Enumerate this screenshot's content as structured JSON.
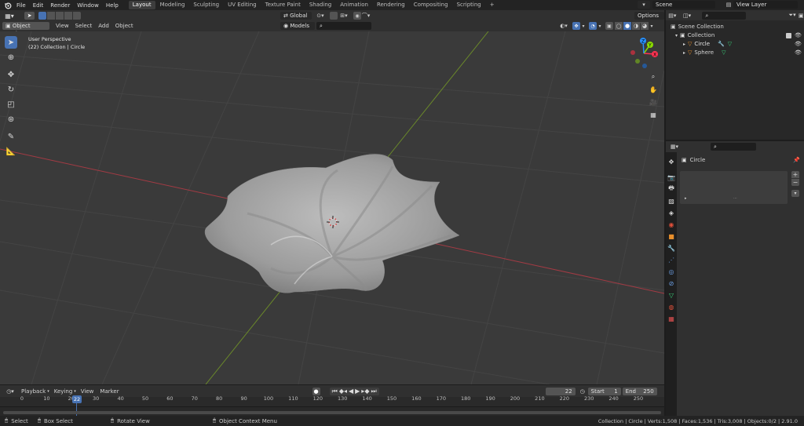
{
  "menubar": {
    "items": [
      "File",
      "Edit",
      "Render",
      "Window",
      "Help"
    ],
    "workspaces": [
      "Layout",
      "Modeling",
      "Sculpting",
      "UV Editing",
      "Texture Paint",
      "Shading",
      "Animation",
      "Rendering",
      "Compositing",
      "Scripting"
    ],
    "active_workspace": "Layout",
    "add_tab": "+",
    "scene": "Scene",
    "view_layer": "View Layer"
  },
  "viewport_header": {
    "mode": "Object Mode",
    "menus": [
      "View",
      "Select",
      "Add",
      "Object"
    ],
    "transform_orientation": "Global",
    "collection_filter": "Models",
    "options": "Options"
  },
  "viewport": {
    "perspective_label": "User Perspective",
    "collection_label": "(22) Collection | Circle",
    "gizmo": {
      "x": "X",
      "y": "Y",
      "z": "Z"
    },
    "colors": {
      "x_axis": "#ff3352",
      "y_axis": "#8bdc00",
      "z_axis": "#2890ff"
    }
  },
  "outliner": {
    "root": "Scene Collection",
    "collection": "Collection",
    "objects": [
      "Circle",
      "Sphere"
    ]
  },
  "properties": {
    "object_name": "Circle"
  },
  "timeline": {
    "menus": [
      "Playback",
      "Keying",
      "View",
      "Marker"
    ],
    "current_frame": "22",
    "start_label": "Start",
    "start_value": "1",
    "end_label": "End",
    "end_value": "250",
    "ticks": [
      "0",
      "10",
      "20",
      "30",
      "40",
      "50",
      "60",
      "70",
      "80",
      "90",
      "100",
      "110",
      "120",
      "130",
      "140",
      "150",
      "160",
      "170",
      "180",
      "190",
      "200",
      "210",
      "220",
      "230",
      "240",
      "250"
    ]
  },
  "statusbar": {
    "select": "Select",
    "box_select": "Box Select",
    "rotate_view": "Rotate View",
    "context_menu": "Object Context Menu",
    "stats": "Collection | Circle | Verts:1,508 | Faces:1,536 | Tris:3,008 | Objects:0/2 | 2.91.0"
  }
}
